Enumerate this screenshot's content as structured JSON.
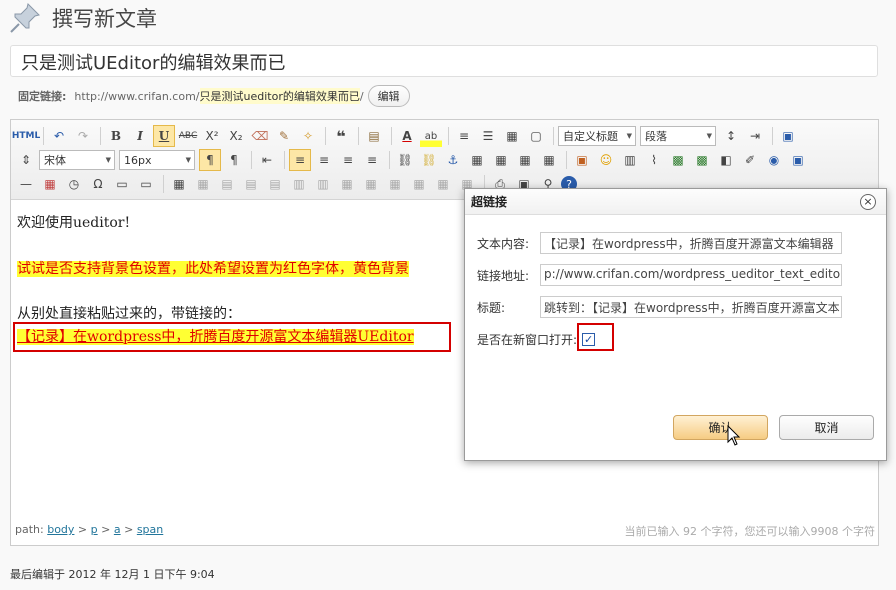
{
  "header": {
    "title": "撰写新文章",
    "icon": "pushpin-icon"
  },
  "post": {
    "title": "只是测试UEditor的编辑效果而已"
  },
  "permalink": {
    "label": "固定链接:",
    "base": "http://www.crifan.com/",
    "slug": "只是测试ueditor的编辑效果而已",
    "suffix": "/",
    "edit_label": "编辑"
  },
  "toolbar": {
    "paragraph_format": "自定义标题",
    "block_format": "段落",
    "font_family": "宋体",
    "font_size": "16px"
  },
  "content": {
    "line1": "欢迎使用ueditor!",
    "line2": "试试是否支持背景色设置，此处希望设置为红色字体，黄色背景",
    "line3": "从别处直接粘贴过来的，带链接的：",
    "link_text": "【记录】在wordpress中，折腾百度开源富文本编辑器UEditor"
  },
  "statusbar": {
    "path_label": "path:",
    "path": [
      "body",
      "p",
      "a",
      "span"
    ],
    "count": "当前已输入 92 个字符，您还可以输入9908 个字符"
  },
  "last_edit": "最后编辑于 2012 年 12月 1 日下午 9:04",
  "dialog": {
    "title": "超链接",
    "text_label": "文本内容:",
    "text_value": "【记录】在wordpress中，折腾百度开源富文本编辑器",
    "url_label": "链接地址:",
    "url_value": "p://www.crifan.com/wordpress_ueditor_text_editor/",
    "title_label": "标题:",
    "title_value": "跳转到：【记录】在wordpress中，折腾百度开源富文本",
    "newwin_label": "是否在新窗口打开:",
    "newwin_checked": true,
    "ok_label": "确认",
    "cancel_label": "取消"
  },
  "colors": {
    "accent_red": "#d40000",
    "highlight_yellow": "#ffff33",
    "link_blue": "#21759b"
  }
}
